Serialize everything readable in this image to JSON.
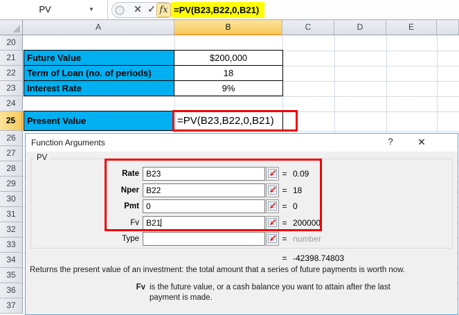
{
  "name_box": {
    "value": "PV",
    "dropdown_icon": "▼"
  },
  "formula_bar": {
    "formula": "=PV(B23,B22,0,B21)",
    "cancel_icon": "✕",
    "enter_icon": "✓",
    "fx_label": "fx"
  },
  "grid": {
    "column_headers": [
      "A",
      "B",
      "C",
      "D",
      "E"
    ],
    "selected_column": "B",
    "row_numbers": [
      20,
      21,
      22,
      23,
      24,
      25,
      26,
      27,
      28,
      29,
      30,
      31,
      32,
      33,
      34,
      35,
      36,
      37
    ],
    "selected_row": 25,
    "table": [
      {
        "row": 21,
        "label": "Future Value",
        "value": "$200,000"
      },
      {
        "row": 22,
        "label": "Term of Loan (no. of periods)",
        "value": "18"
      },
      {
        "row": 23,
        "label": "Interest Rate",
        "value": "9%"
      },
      {
        "row": 25,
        "label": "Present Value",
        "value": "=PV(B23,B22,0,B21)",
        "formula": true
      }
    ]
  },
  "dialog": {
    "title": "Function Arguments",
    "help_icon": "?",
    "close_icon": "✕",
    "group_label": "PV",
    "fields": [
      {
        "label": "Rate",
        "value": "B23",
        "eq": "=",
        "result": "0.09",
        "required": true,
        "muted": false,
        "caret": false
      },
      {
        "label": "Nper",
        "value": "B22",
        "eq": "=",
        "result": "18",
        "required": true,
        "muted": false,
        "caret": false
      },
      {
        "label": "Pmt",
        "value": "0",
        "eq": "=",
        "result": "0",
        "required": true,
        "muted": false,
        "caret": false
      },
      {
        "label": "Fv",
        "value": "B21",
        "eq": "=",
        "result": "200000",
        "required": false,
        "muted": false,
        "caret": true
      },
      {
        "label": "Type",
        "value": "",
        "eq": "=",
        "result": "number",
        "required": false,
        "muted": true,
        "caret": false
      }
    ],
    "result_eq": "=",
    "result_value": "-42398.74803",
    "description": "Returns the present value of an investment: the total amount that a series of future payments is worth now.",
    "arg_help": {
      "term": "Fv",
      "line1": "is the future value, or a cash balance you want to attain after the last",
      "line2": "payment is made."
    }
  },
  "colors": {
    "cell_fill": "#00B0F0",
    "formula_highlight": "#FFFF00",
    "annotation_red": "#F10000",
    "selected_header": "#F7C95C"
  }
}
